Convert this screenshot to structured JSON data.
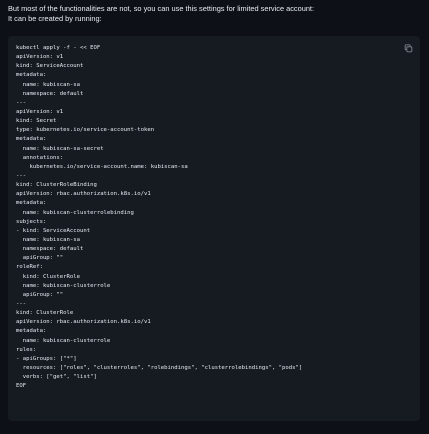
{
  "intro": {
    "line1": "But most of the functionalities are not, so you can use this settings for limited service account:",
    "line2": "It can be created by running:"
  },
  "code_block": {
    "copy_icon": "copy-icon",
    "lines": [
      "kubectl apply -f - << EOF",
      "apiVersion: v1",
      "kind: ServiceAccount",
      "metadata:",
      "  name: kubiscan-sa",
      "  namespace: default",
      "---",
      "apiVersion: v1",
      "kind: Secret",
      "type: kubernetes.io/service-account-token",
      "metadata:",
      "  name: kubiscan-sa-secret",
      "  annotations:",
      "    kubernetes.io/service-account.name: kubiscan-sa",
      "---",
      "kind: ClusterRoleBinding",
      "apiVersion: rbac.authorization.k8s.io/v1",
      "metadata:",
      "  name: kubiscan-clusterrolebinding",
      "subjects:",
      "- kind: ServiceAccount",
      "  name: kubiscan-sa",
      "  namespace: default",
      "  apiGroup: \"\"",
      "roleRef:",
      "  kind: ClusterRole",
      "  name: kubiscan-clusterrole",
      "  apiGroup: \"\"",
      "---",
      "kind: ClusterRole",
      "apiVersion: rbac.authorization.k8s.io/v1",
      "metadata:",
      "  name: kubiscan-clusterrole",
      "rules:",
      "- apiGroups: [\"*\"]",
      "  resources: [\"roles\", \"clusterroles\", \"rolebindings\", \"clusterrolebindings\", \"pods\"]",
      "  verbs: [\"get\", \"list\"]",
      "EOF"
    ]
  }
}
